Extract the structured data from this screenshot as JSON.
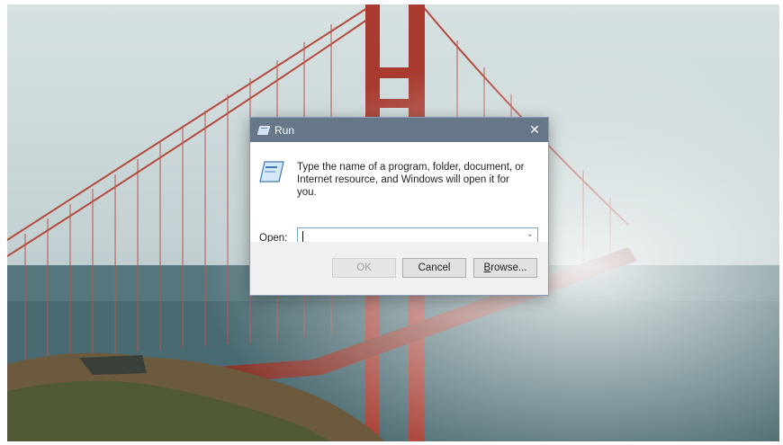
{
  "wallpaper": {
    "description_icon": "golden-gate-bridge-in-fog"
  },
  "dialog": {
    "title": "Run",
    "close_glyph": "✕",
    "prompt_line1": "Type the name of a program, folder, document, or",
    "prompt_line2": "Internet resource, and Windows will open it for you.",
    "open_label_accel": "O",
    "open_label_rest": "pen:",
    "open_value": "",
    "combo_arrow": "⌄",
    "ok_label": "OK",
    "cancel_label": "Cancel",
    "browse_accel": "B",
    "browse_rest": "rowse..."
  },
  "colors": {
    "titlebar": "#667789",
    "sky": "#c9d6d8",
    "bridge": "#a33a2e",
    "water": "#4b6e76"
  }
}
